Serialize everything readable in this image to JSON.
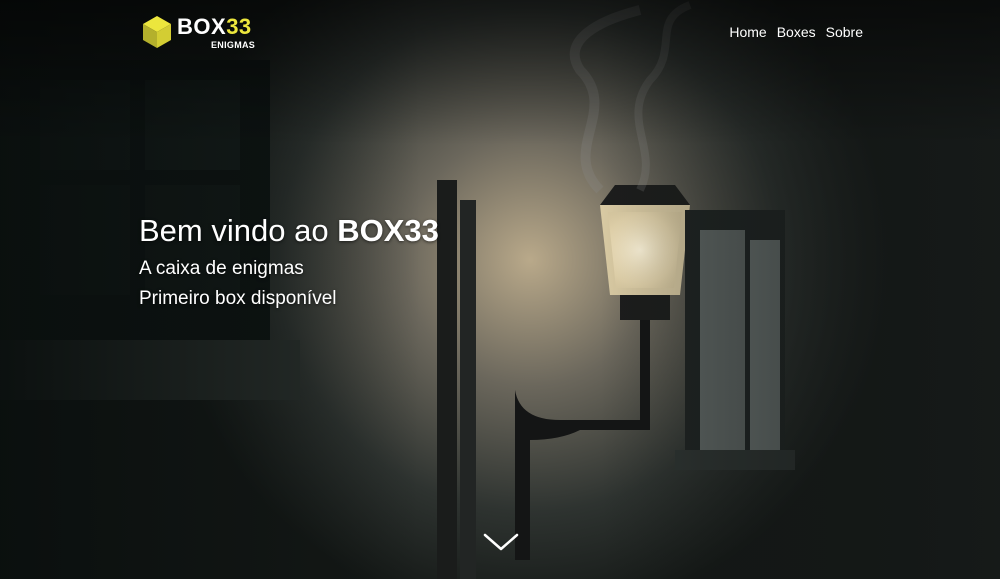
{
  "brand": {
    "name_prefix": "BOX",
    "name_number": "33",
    "subtitle": "ENIGMAS",
    "accent_color": "#ece63d"
  },
  "nav": {
    "items": [
      "Home",
      "Boxes",
      "Sobre"
    ]
  },
  "hero": {
    "title_prefix": "Bem vindo ao",
    "title_brand": "BOX33",
    "line1": "A caixa de enigmas",
    "line2": "Primeiro box disponível"
  },
  "scroll_icon": "chevron-down-icon"
}
